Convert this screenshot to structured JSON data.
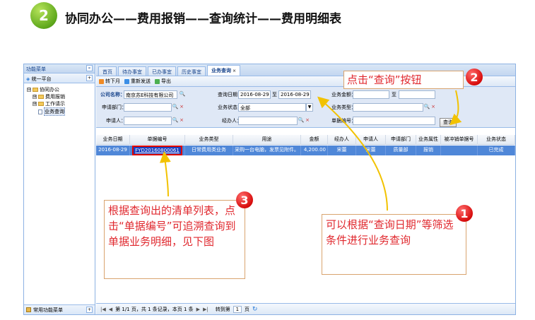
{
  "header": {
    "step_number": "2",
    "title": "协同办公——费用报销——查询统计——费用明细表"
  },
  "sidebar": {
    "menu_title": "功能菜单",
    "collapse_icon": "«",
    "platform": "统一平台",
    "tree": [
      {
        "label": "协同办公",
        "toggle": "⊟",
        "level": 0,
        "type": "folder"
      },
      {
        "label": "费用报销",
        "toggle": "⊞",
        "level": 1,
        "type": "folder"
      },
      {
        "label": "工作请示",
        "toggle": "⊞",
        "level": 1,
        "type": "folder"
      },
      {
        "label": "业务查询",
        "toggle": "",
        "level": 2,
        "type": "doc",
        "selected": true
      }
    ],
    "footer": "常用功能菜单"
  },
  "tabs": [
    {
      "label": "首页",
      "active": false
    },
    {
      "label": "待办事宜",
      "active": false
    },
    {
      "label": "已办事宜",
      "active": false
    },
    {
      "label": "历史事宜",
      "active": false
    },
    {
      "label": "业务查询",
      "active": true,
      "close": "×"
    }
  ],
  "toolbar": {
    "refresh": "转下月",
    "resend": "重新发送",
    "export": "导出"
  },
  "form": {
    "company_label": "公司名称：",
    "company_value": "南京苏E科技有限公司",
    "query_date_label": "查询日期：",
    "date_from": "2016-08-29",
    "date_sep": "至",
    "date_to": "2016-08-29",
    "amount_label": "业务金额：",
    "amount_from": "",
    "amount_sep": "至",
    "amount_to": "",
    "dept_label": "申请部门：",
    "dept_value": "",
    "status_label": "业务状态：",
    "status_value": "全部",
    "type_label": "业务类型：",
    "type_value": "",
    "applicant_label": "申请人：",
    "applicant_value": "",
    "handler_label": "经办人：",
    "handler_value": "",
    "billno_label": "单据编号：",
    "billno_value": "",
    "search_glyph": "🔍",
    "clear_glyph": "×",
    "dropdown_glyph": "▼",
    "query_button": "查询"
  },
  "table": {
    "columns": [
      "业务日期",
      "单据编号",
      "业务类型",
      "用途",
      "金额",
      "经办人",
      "申请人",
      "申请部门",
      "业务属性",
      "被冲销单据号",
      "业务状态"
    ],
    "rows": [
      [
        "2016-08-29",
        "FYD20160800061",
        "日常费用类业务",
        "采购一台电脑，发票见附件。",
        "4,200.00",
        "宋蕾",
        "宋蕾",
        "质量部",
        "报销",
        "",
        "已完成"
      ]
    ]
  },
  "pager": {
    "first": "|◀",
    "prev": "◀",
    "info": "第 1/1 页，共 1 条记录，本页 1 条",
    "next": "▶",
    "last": "▶|",
    "goto_label": "转到第",
    "goto_value": "1",
    "page_unit": "页",
    "refresh_icon": "↻"
  },
  "callouts": {
    "c1_badge": "1",
    "c1_text": "可以根据“查询日期”等筛选条件进行业务查询",
    "c2_badge": "2",
    "c2_text": "点击“查询”按钮",
    "c3_badge": "3",
    "c3_text": "根据查询出的清单列表，点击“单据编号”可追溯查询到单据业务明细，见下图"
  },
  "colors": {
    "accent_red": "#e0282e",
    "arrow_yellow": "#f2c200",
    "selected_row": "#4f87d8",
    "step_green": "#5fa81c"
  }
}
